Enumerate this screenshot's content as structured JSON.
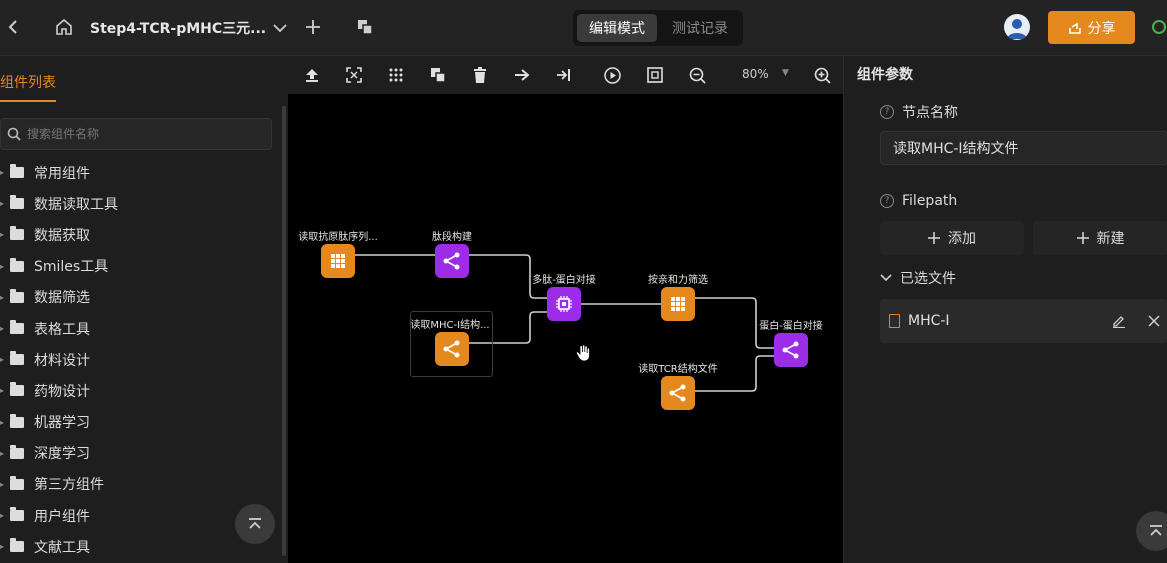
{
  "window": {
    "title": "Step4-TCR-pMHC三元...",
    "modes": {
      "edit": "编辑模式",
      "test": "测试记录"
    },
    "share_label": "分享"
  },
  "left_panel": {
    "title": "组件列表",
    "search_placeholder": "搜索组件名称",
    "categories": [
      "常用组件",
      "数据读取工具",
      "数据获取",
      "Smiles工具",
      "数据筛选",
      "表格工具",
      "材料设计",
      "药物设计",
      "机器学习",
      "深度学习",
      "第三方组件",
      "用户组件",
      "文献工具"
    ]
  },
  "toolbar": {
    "zoom": "80%"
  },
  "canvas": {
    "nodes": [
      {
        "label": "读取抗原肽序列...",
        "color": "orange",
        "icon": "table-icon"
      },
      {
        "label": "肽段构建",
        "color": "purple",
        "icon": "share-icon"
      },
      {
        "label": "读取MHC-I结构...",
        "color": "orange",
        "icon": "share-icon"
      },
      {
        "label": "多肽-蛋白对接",
        "color": "purple",
        "icon": "chip-icon"
      },
      {
        "label": "按亲和力筛选",
        "color": "orange",
        "icon": "table-icon"
      },
      {
        "label": "读取TCR结构文件",
        "color": "orange",
        "icon": "share-icon"
      },
      {
        "label": "蛋白-蛋白对接",
        "color": "purple",
        "icon": "share-icon"
      }
    ]
  },
  "right_panel": {
    "title": "组件参数",
    "node_name_label": "节点名称",
    "node_name_value": "读取MHC-I结构文件",
    "filepath_label": "Filepath",
    "add_label": "添加",
    "new_label": "新建",
    "selected_files_label": "已选文件",
    "files": [
      "MHC-I"
    ]
  },
  "colors": {
    "accent": "#e5891e",
    "purple_node": "#9b2de8",
    "canvas_bg": "#000000"
  }
}
